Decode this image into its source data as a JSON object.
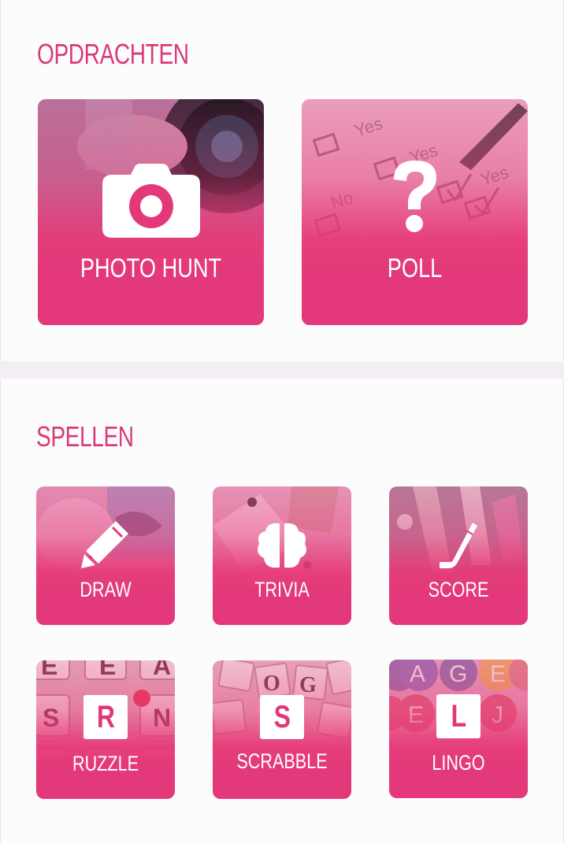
{
  "sections": {
    "opdrachten": {
      "title": "OPDRACHTEN",
      "tiles": [
        {
          "label": "PHOTO HUNT",
          "icon": "camera-icon"
        },
        {
          "label": "POLL",
          "icon": "question-mark-icon"
        }
      ]
    },
    "spellen": {
      "title": "SPELLEN",
      "tiles": [
        {
          "label": "DRAW",
          "icon": "pencil-icon"
        },
        {
          "label": "TRIVIA",
          "icon": "brain-icon"
        },
        {
          "label": "SCORE",
          "icon": "hockey-stick-icon"
        },
        {
          "label": "RUZZLE",
          "letter": "R"
        },
        {
          "label": "SCRABBLE",
          "letter": "S"
        },
        {
          "label": "LINGO",
          "letter": "L"
        }
      ]
    }
  },
  "colors": {
    "accent": "#d93a78",
    "tile_pink": "#e3397a",
    "background": "#f3eef3",
    "panel": "#fdfcfd"
  }
}
